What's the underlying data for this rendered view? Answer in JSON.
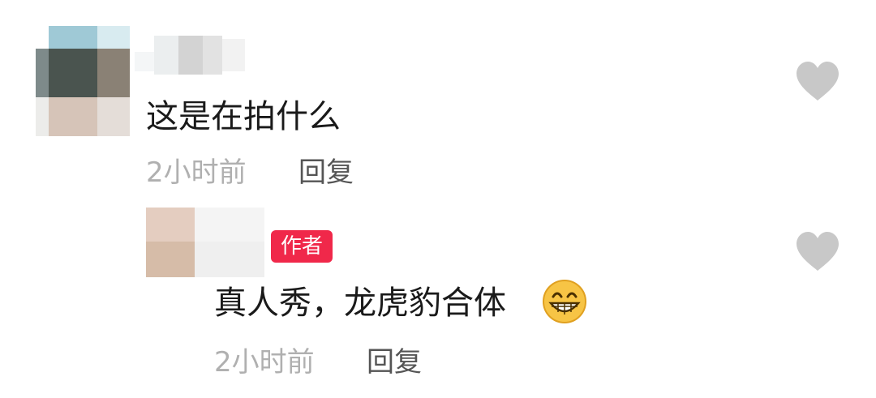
{
  "comments": [
    {
      "text": "这是在拍什么",
      "time": "2小时前",
      "reply_label": "回复",
      "like_icon": "heart-icon"
    },
    {
      "badge": "作者",
      "text": "真人秀，龙虎豹合体",
      "emoji": "grinning-face-emoji",
      "time": "2小时前",
      "reply_label": "回复",
      "like_icon": "heart-icon"
    }
  ],
  "colors": {
    "badge": "#f0284a",
    "text": "#1a1a1a",
    "meta": "#b0b0b0",
    "reply": "#555555",
    "heart": "#c8c8c8"
  }
}
